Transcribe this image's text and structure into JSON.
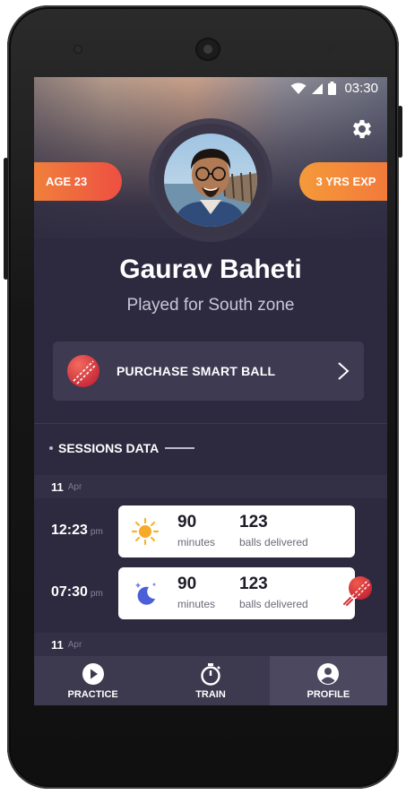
{
  "status_bar": {
    "time": "03:30",
    "icons": [
      "wifi-icon",
      "signal-icon",
      "battery-icon"
    ]
  },
  "profile": {
    "age_badge": "AGE 23",
    "experience_badge": "3 YRS EXP",
    "name": "Gaurav Baheti",
    "subtitle": "Played for South zone"
  },
  "purchase": {
    "label": "PURCHASE SMART BALL",
    "icon": "cricket-ball-icon",
    "chevron": "chevron-right-icon"
  },
  "sessions": {
    "title": "SESSIONS DATA",
    "groups": [
      {
        "date_day": "11",
        "date_month": "Apr",
        "entries": [
          {
            "time": "12:23",
            "meridiem": "pm",
            "weather": "sun-icon",
            "minutes_value": "90",
            "minutes_label": "minutes",
            "balls_value": "123",
            "balls_label": "balls delivered"
          },
          {
            "time": "07:30",
            "meridiem": "pm",
            "weather": "moon-stars-icon",
            "minutes_value": "90",
            "minutes_label": "minutes",
            "balls_value": "123",
            "balls_label": "balls delivered"
          }
        ]
      },
      {
        "date_day": "11",
        "date_month": "Apr",
        "entries": []
      }
    ]
  },
  "bottom_nav": {
    "items": [
      {
        "label": "PRACTICE",
        "icon": "play-icon",
        "active": false
      },
      {
        "label": "TRAIN",
        "icon": "stopwatch-icon",
        "active": false
      },
      {
        "label": "PROFILE",
        "icon": "user-icon",
        "active": true
      }
    ]
  },
  "colors": {
    "background": "#2d2a40",
    "accent_orange": "#f27a3a",
    "accent_red": "#ee4f41",
    "card": "#ffffff",
    "ball_red": "#d6333e"
  }
}
